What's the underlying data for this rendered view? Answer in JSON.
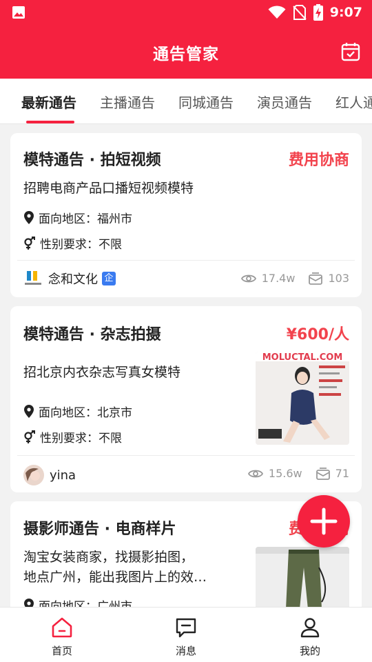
{
  "status_bar": {
    "time": "9:07"
  },
  "app_bar": {
    "title": "通告管家"
  },
  "tabs": [
    {
      "label": "最新通告",
      "active": true
    },
    {
      "label": "主播通告",
      "active": false
    },
    {
      "label": "同城通告",
      "active": false
    },
    {
      "label": "演员通告",
      "active": false
    },
    {
      "label": "红人通",
      "active": false
    }
  ],
  "cards": [
    {
      "title": "模特通告 · 拍短视频",
      "price": "费用协商",
      "desc": "招聘电商产品口播短视频模特",
      "region_label": "面向地区：",
      "region": "福州市",
      "gender_label": "性别要求：",
      "gender": "不限",
      "author": "念和文化",
      "author_badge": "企",
      "views": "17.4w",
      "applies": "103"
    },
    {
      "title": "模特通告 · 杂志拍摄",
      "price": "¥600/人",
      "desc": "招北京内衣杂志写真女模特",
      "region_label": "面向地区：",
      "region": "北京市",
      "gender_label": "性别要求：",
      "gender": "不限",
      "author": "yina",
      "views": "15.6w",
      "applies": "71",
      "thumb_text": "MOLUCTAL.COM"
    },
    {
      "title": "摄影师通告 · 电商样片",
      "price": "费用协商",
      "desc_line1": "淘宝女装商家，找摄影拍图，",
      "desc_line2": "地点广州，能出我图片上的效…",
      "region_label": "面向地区：",
      "region": "广州市"
    }
  ],
  "bottom_nav": [
    {
      "label": "首页",
      "icon": "home-icon",
      "active": true
    },
    {
      "label": "消息",
      "icon": "message-icon",
      "active": false
    },
    {
      "label": "我的",
      "icon": "profile-icon",
      "active": false
    }
  ],
  "colors": {
    "primary": "#f5213f",
    "price": "#f2434d",
    "badge": "#3a7bf0"
  }
}
